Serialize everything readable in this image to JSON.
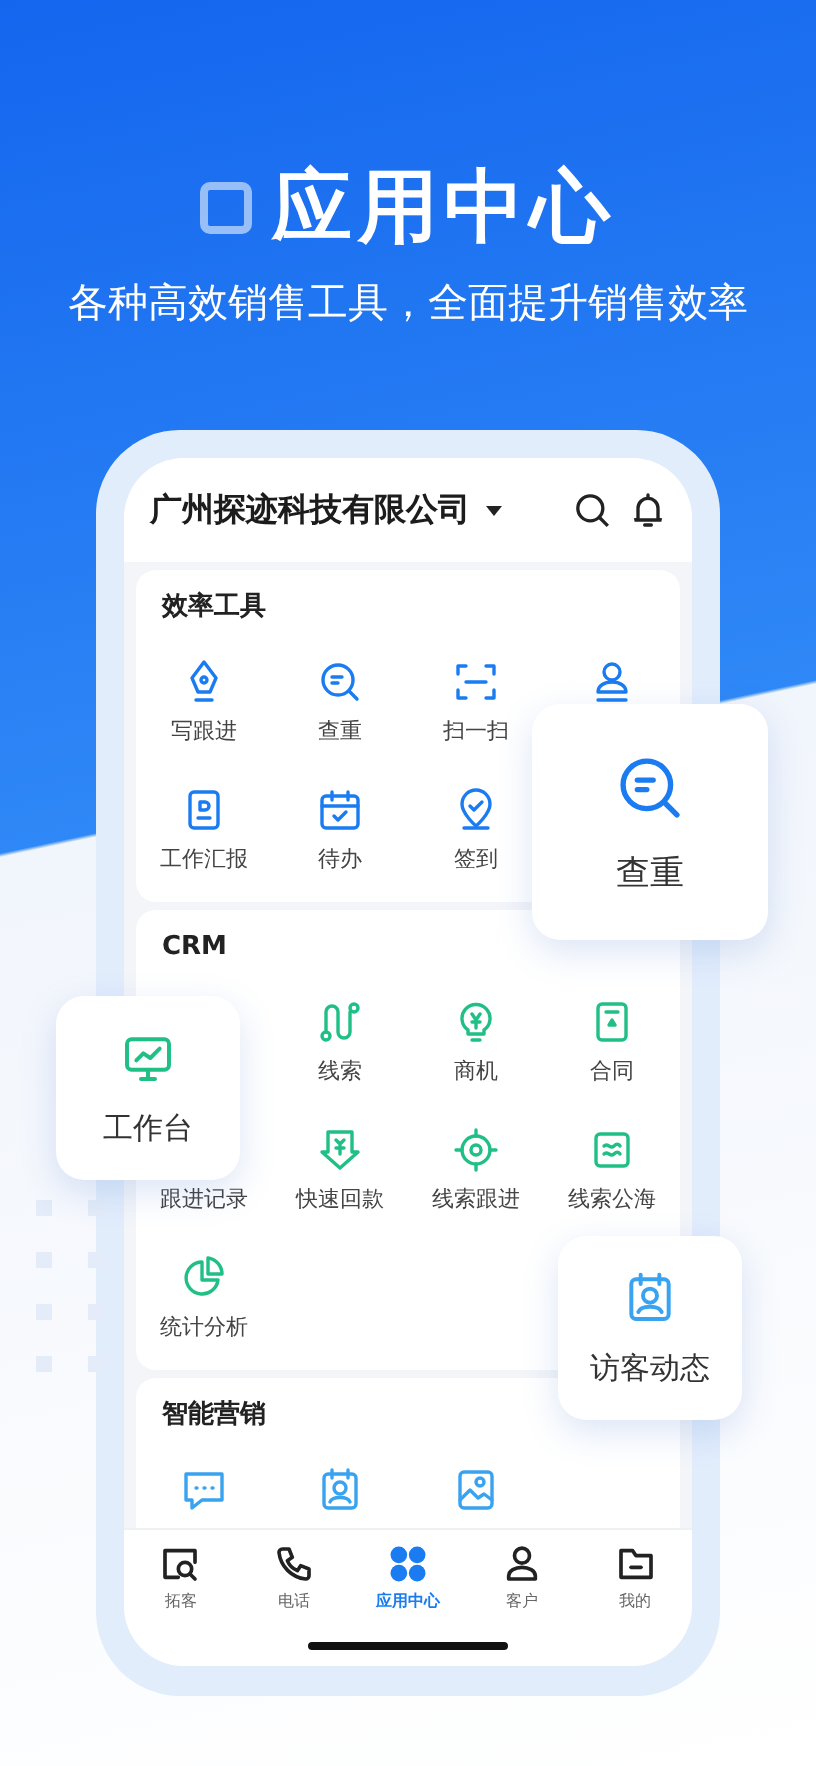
{
  "hero": {
    "title": "应用中心",
    "subtitle": "各种高效销售工具，全面提升销售效率"
  },
  "header": {
    "company": "广州探迹科技有限公司"
  },
  "sections": [
    {
      "title": "效率工具",
      "items": [
        {
          "kind": "tool",
          "label": "写跟进"
        },
        {
          "kind": "tool",
          "label": "查重"
        },
        {
          "kind": "tool",
          "label": "扫一扫"
        },
        {
          "kind": "icon_only"
        },
        {
          "kind": "tool",
          "label": "工作汇报"
        },
        {
          "kind": "tool",
          "label": "待办"
        },
        {
          "kind": "tool",
          "label": "签到"
        }
      ]
    },
    {
      "title": "CRM",
      "items": [
        {
          "kind": "covered"
        },
        {
          "kind": "tool",
          "label": "线索"
        },
        {
          "kind": "tool",
          "label": "商机"
        },
        {
          "kind": "tool",
          "label": "合同"
        },
        {
          "kind": "label_only",
          "label": "跟进记录"
        },
        {
          "kind": "tool",
          "label": "快速回款"
        },
        {
          "kind": "tool",
          "label": "线索跟进"
        },
        {
          "kind": "tool",
          "label": "线索公海"
        },
        {
          "kind": "tool",
          "label": "统计分析"
        }
      ]
    },
    {
      "title": "智能营销",
      "items": [
        {
          "kind": "icon_only"
        },
        {
          "kind": "icon_only"
        },
        {
          "kind": "icon_only"
        }
      ]
    }
  ],
  "tabs": [
    {
      "label": "拓客",
      "selected": false
    },
    {
      "label": "电话",
      "selected": false
    },
    {
      "label": "应用中心",
      "selected": true
    },
    {
      "label": "客户",
      "selected": false
    },
    {
      "label": "我的",
      "selected": false
    }
  ],
  "floating_cards": [
    {
      "label": "查重"
    },
    {
      "label": "工作台"
    },
    {
      "label": "访客动态"
    }
  ]
}
